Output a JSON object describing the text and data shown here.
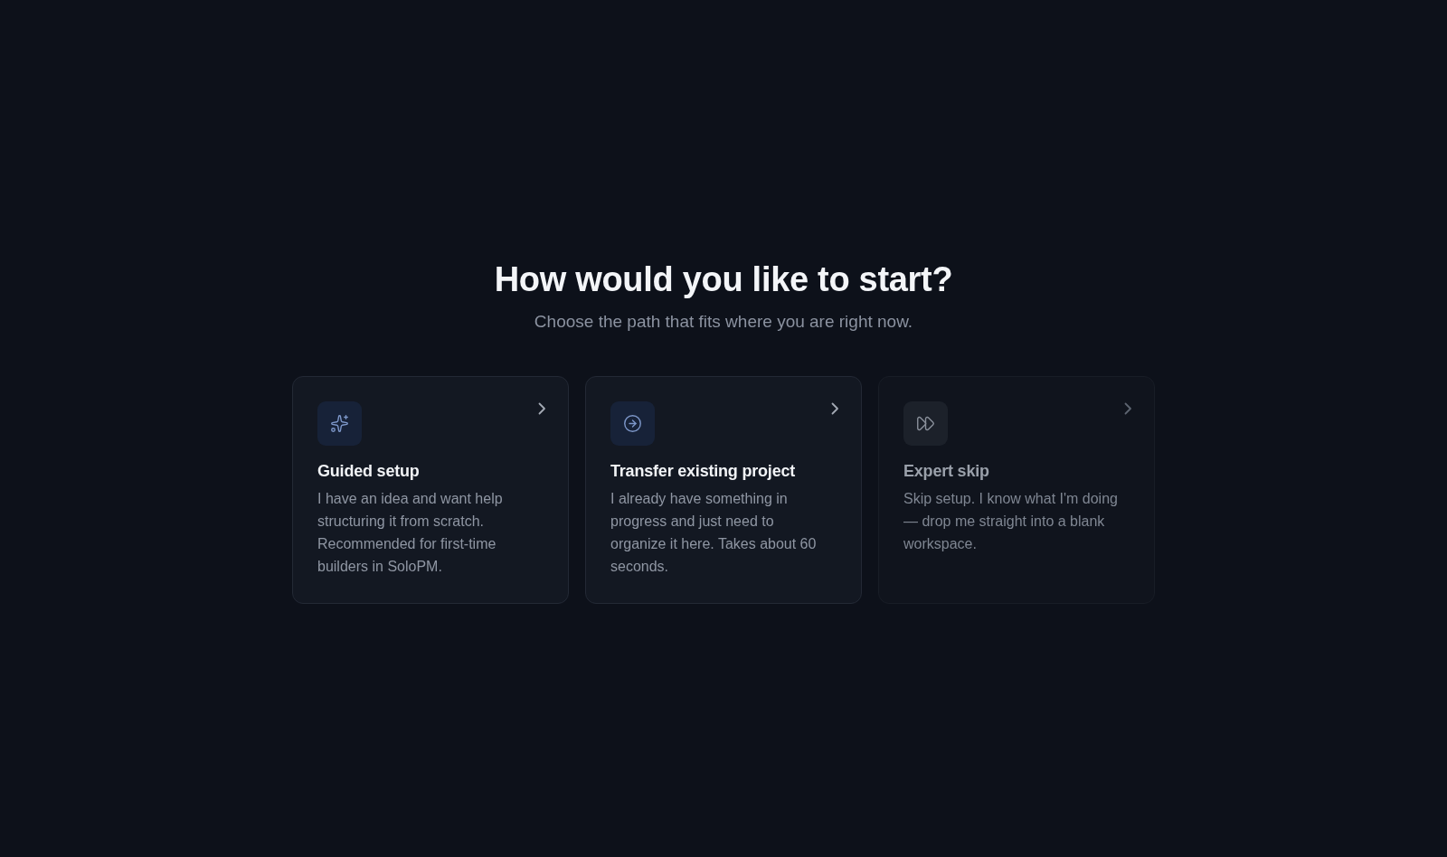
{
  "heading": {
    "title": "How would you like to start?",
    "subtitle": "Choose the path that fits where you are right now."
  },
  "cards": [
    {
      "kind": "guided",
      "title": "Guided setup",
      "description": "I have an idea and want help structuring it from scratch. Recommended for first-time builders in SoloPM.",
      "muted": false
    },
    {
      "kind": "transfer",
      "title": "Transfer existing project",
      "description": "I already have something in progress and just need to organize it here. Takes about 60 seconds.",
      "muted": false
    },
    {
      "kind": "skip",
      "title": "Expert skip",
      "description": "Skip setup. I know what I'm doing — drop me straight into a blank workspace.",
      "muted": true
    }
  ]
}
